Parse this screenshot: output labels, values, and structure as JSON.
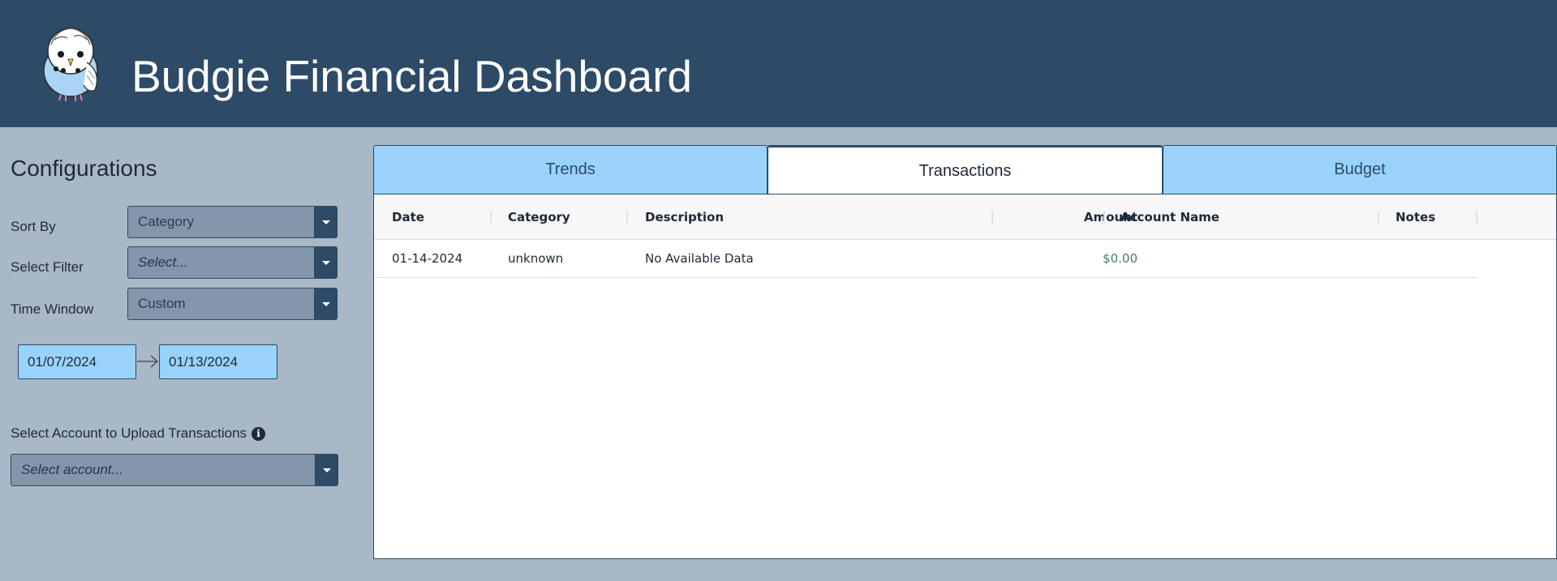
{
  "header": {
    "title": "Budgie Financial Dashboard",
    "logo_icon": "budgie-bird-icon"
  },
  "sidebar": {
    "title": "Configurations",
    "sort_by": {
      "label": "Sort By",
      "value": "Category"
    },
    "select_filter": {
      "label": "Select Filter",
      "placeholder": "Select..."
    },
    "time_window": {
      "label": "Time Window",
      "value": "Custom"
    },
    "date_range": {
      "start": "01/07/2024",
      "end": "01/13/2024"
    },
    "upload": {
      "label": "Select Account to Upload Transactions",
      "placeholder": "Select account...",
      "info_icon": "info-icon"
    }
  },
  "tabs": [
    {
      "label": "Trends",
      "active": false
    },
    {
      "label": "Transactions",
      "active": true
    },
    {
      "label": "Budget",
      "active": false
    }
  ],
  "table": {
    "columns": [
      "Date",
      "Category",
      "Description",
      "Amount",
      "Account Name",
      "Notes"
    ],
    "rows": [
      {
        "date": "01-14-2024",
        "category": "unknown",
        "description": "No Available Data",
        "amount": "$0.00",
        "account_name": "",
        "notes": ""
      }
    ]
  },
  "colors": {
    "header_bg": "#2d4a67",
    "page_bg": "#a9b8c6",
    "tab_bg": "#99d3fb",
    "amount_text": "#3f7f5a"
  }
}
